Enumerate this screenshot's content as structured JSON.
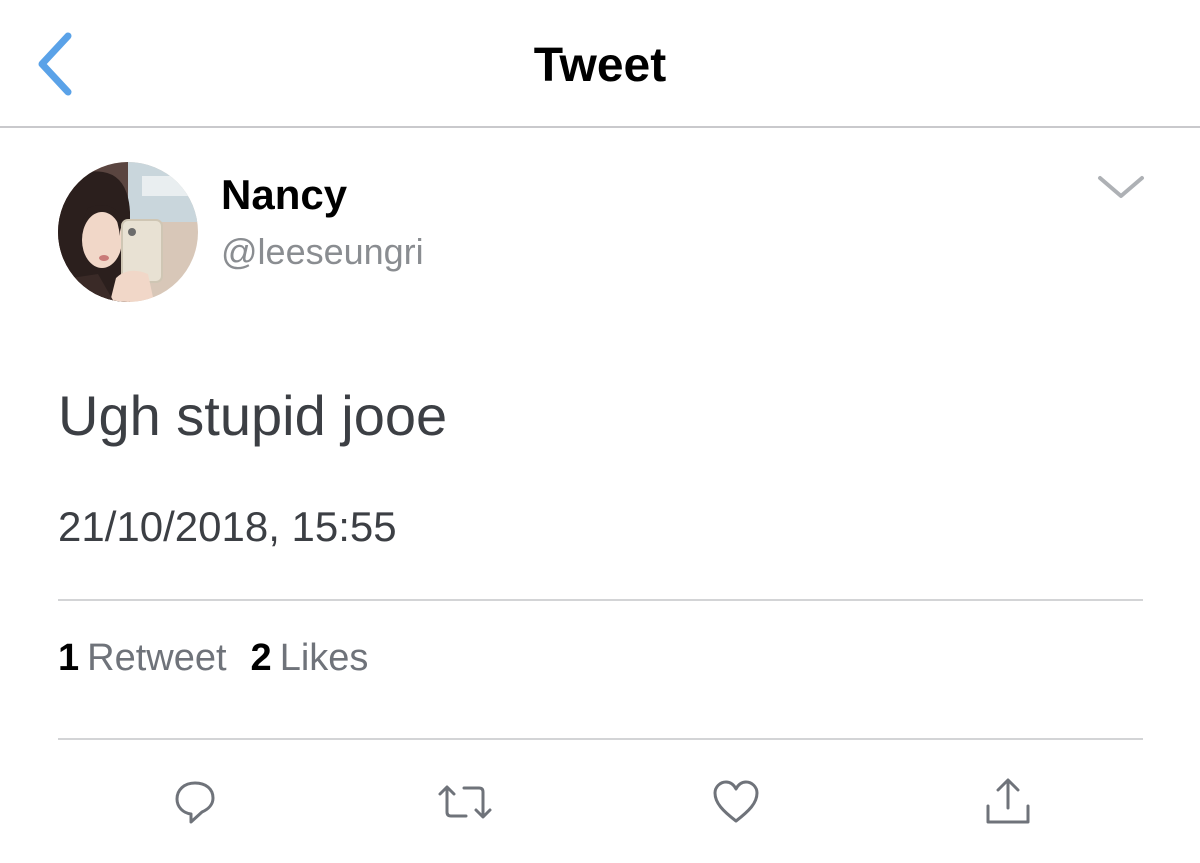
{
  "nav": {
    "title": "Tweet",
    "back_icon": "chevron-left-icon",
    "accent_color": "#5aa2e8"
  },
  "tweet": {
    "author": {
      "name": "Nancy",
      "handle": "@leeseungri"
    },
    "text": "Ugh stupid jooe",
    "timestamp": "21/10/2018, 15:55",
    "stats": {
      "retweets": "1",
      "retweets_label": "Retweet",
      "likes": "2",
      "likes_label": "Likes"
    }
  },
  "actions": [
    {
      "icon": "reply-icon"
    },
    {
      "icon": "retweet-icon"
    },
    {
      "icon": "like-icon"
    },
    {
      "icon": "share-icon"
    }
  ],
  "colors": {
    "primary_text": "#000000",
    "secondary_text": "#8a8d91",
    "body_text": "#3c3f44",
    "divider": "#d3d4d6",
    "icon": "#6f737a"
  }
}
